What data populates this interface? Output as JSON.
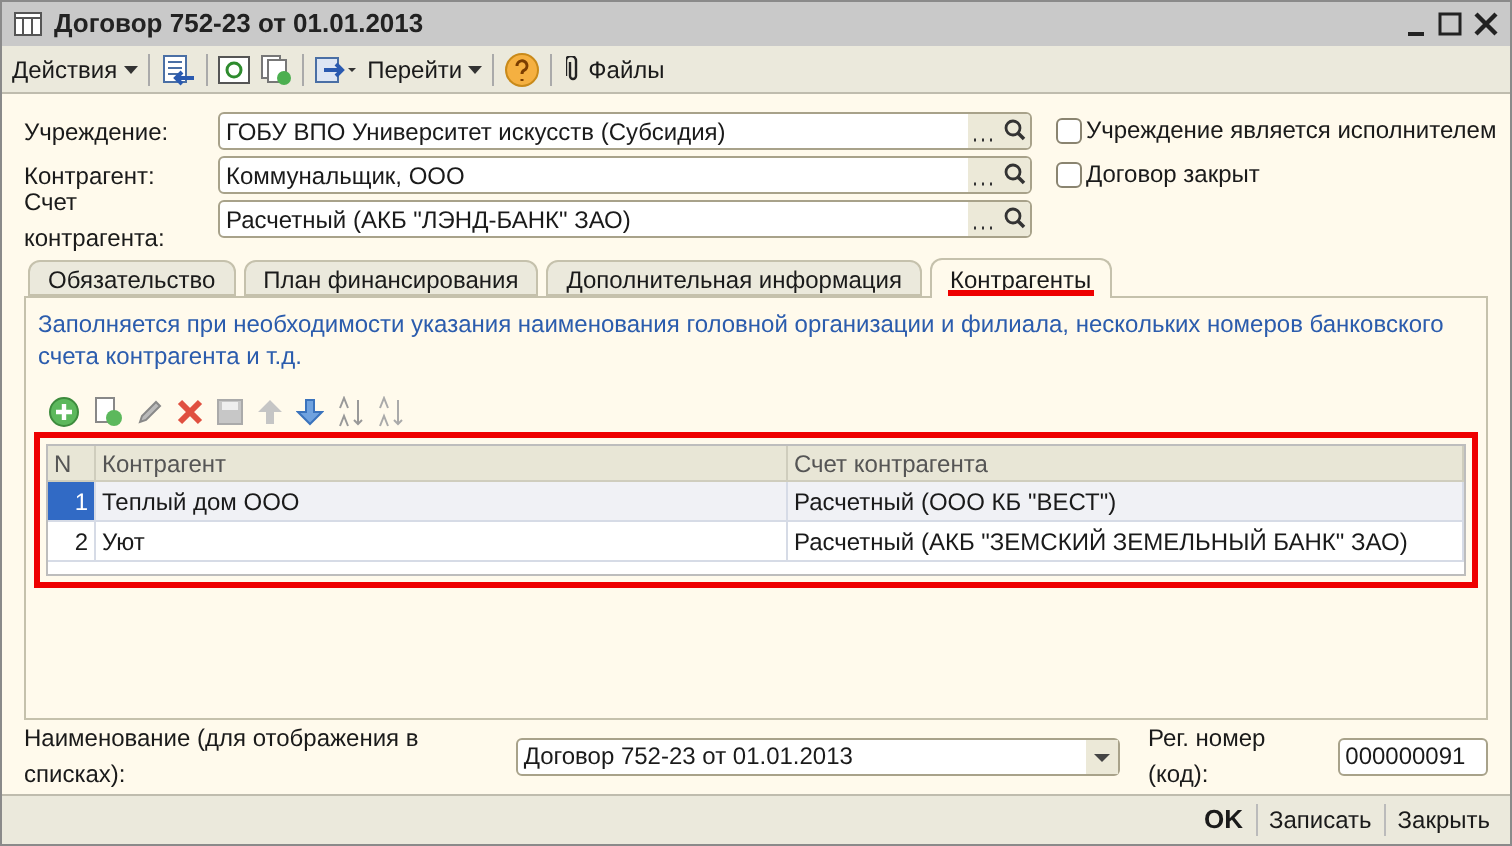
{
  "window": {
    "title": "Договор 752-23 от 01.01.2013"
  },
  "toolbar": {
    "actions": "Действия",
    "goto": "Перейти",
    "files": "Файлы"
  },
  "fields": [
    {
      "label": "Учреждение:",
      "value": "ГОБУ ВПО Университет искусств (Субсидия)"
    },
    {
      "label": "Контрагент:",
      "value": "Коммунальщик, ООО"
    },
    {
      "label": "Счет контрагента:",
      "value": "Расчетный (АКБ \"ЛЭНД-БАНК\" ЗАО)"
    }
  ],
  "checkboxes": [
    {
      "label": "Учреждение является исполнителем",
      "checked": false
    },
    {
      "label": "Договор закрыт",
      "checked": false
    }
  ],
  "tabs": [
    {
      "label": "Обязательство",
      "selected": false
    },
    {
      "label": "План финансирования",
      "selected": false
    },
    {
      "label": "Дополнительная информация",
      "selected": false
    },
    {
      "label": "Контрагенты",
      "selected": true
    }
  ],
  "info_text": "Заполняется при необходимости указания наименования головной организации и филиала, нескольких номеров банковского счета контрагента и т.д.",
  "table": {
    "columns": [
      "N",
      "Контрагент",
      "Счет контрагента"
    ],
    "rows": [
      {
        "n": "1",
        "counterparty": "Теплый дом ООО",
        "account": "Расчетный (ООО КБ \"ВЕСТ\")",
        "selected": true
      },
      {
        "n": "2",
        "counterparty": "Уют",
        "account": "Расчетный (АКБ \"ЗЕМСКИЙ ЗЕМЕЛЬНЫЙ БАНК\" ЗАО)",
        "selected": false
      }
    ]
  },
  "name_field": {
    "label": "Наименование (для отображения в списках):",
    "value": "Договор 752-23 от 01.01.2013"
  },
  "reg_field": {
    "label": "Рег. номер (код):",
    "value": "000000091"
  },
  "buttons": [
    {
      "label": "OK",
      "kind": "default"
    },
    {
      "label": "Записать",
      "kind": "normal"
    },
    {
      "label": "Закрыть",
      "kind": "normal"
    }
  ]
}
